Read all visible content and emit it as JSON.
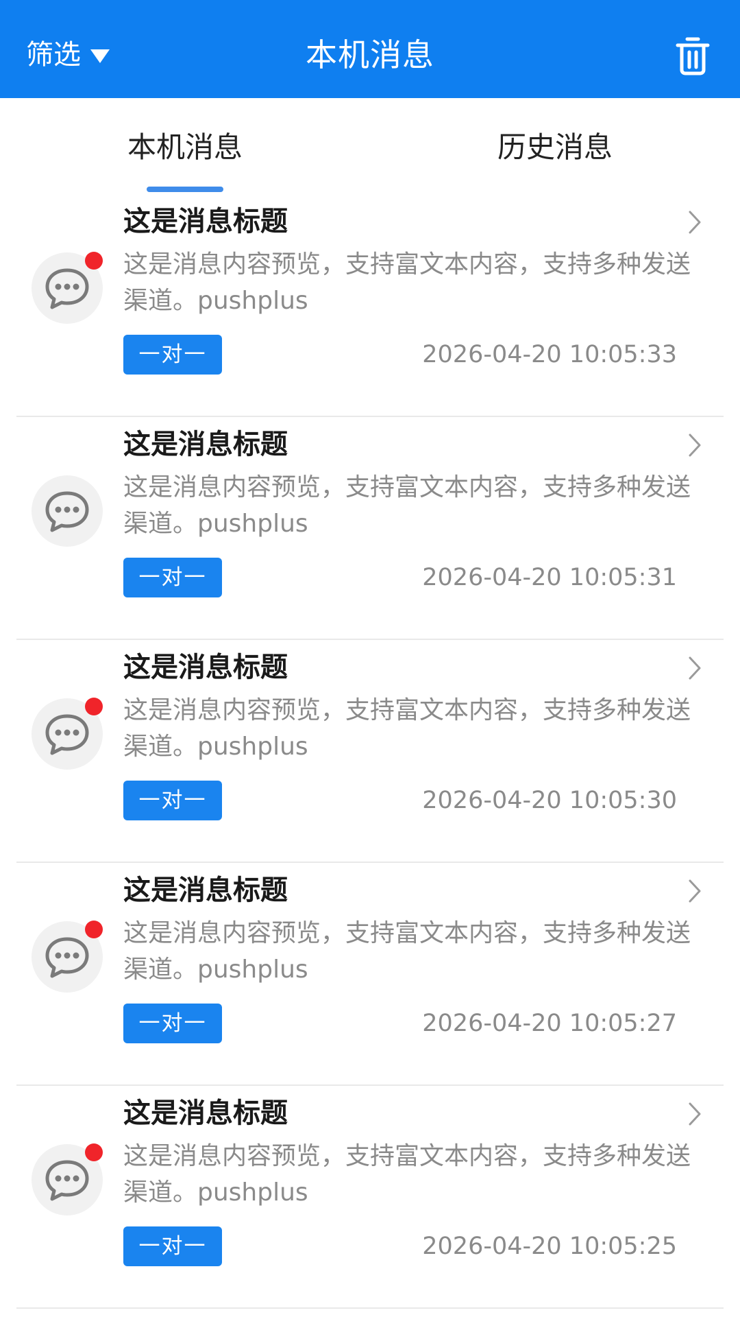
{
  "header": {
    "filter_label": "筛选",
    "title": "本机消息",
    "trash_icon": "trash-icon"
  },
  "tabs": {
    "local": "本机消息",
    "history": "历史消息",
    "active": "local"
  },
  "colors": {
    "primary": "#0f7ff0",
    "badge": "#1a84ef",
    "unread_dot": "#f0242a",
    "text_muted": "#8a8a8a"
  },
  "messages": [
    {
      "title": "这是消息标题",
      "preview": "这是消息内容预览，支持富文本内容，支持多种发送渠道。pushplus",
      "badge": "一对一",
      "time": "2026-04-20 10:05:33",
      "unread": true
    },
    {
      "title": "这是消息标题",
      "preview": "这是消息内容预览，支持富文本内容，支持多种发送渠道。pushplus",
      "badge": "一对一",
      "time": "2026-04-20 10:05:31",
      "unread": false
    },
    {
      "title": "这是消息标题",
      "preview": "这是消息内容预览，支持富文本内容，支持多种发送渠道。pushplus",
      "badge": "一对一",
      "time": "2026-04-20 10:05:30",
      "unread": true
    },
    {
      "title": "这是消息标题",
      "preview": "这是消息内容预览，支持富文本内容，支持多种发送渠道。pushplus",
      "badge": "一对一",
      "time": "2026-04-20 10:05:27",
      "unread": true
    },
    {
      "title": "这是消息标题",
      "preview": "这是消息内容预览，支持富文本内容，支持多种发送渠道。pushplus",
      "badge": "一对一",
      "time": "2026-04-20 10:05:25",
      "unread": true
    }
  ]
}
